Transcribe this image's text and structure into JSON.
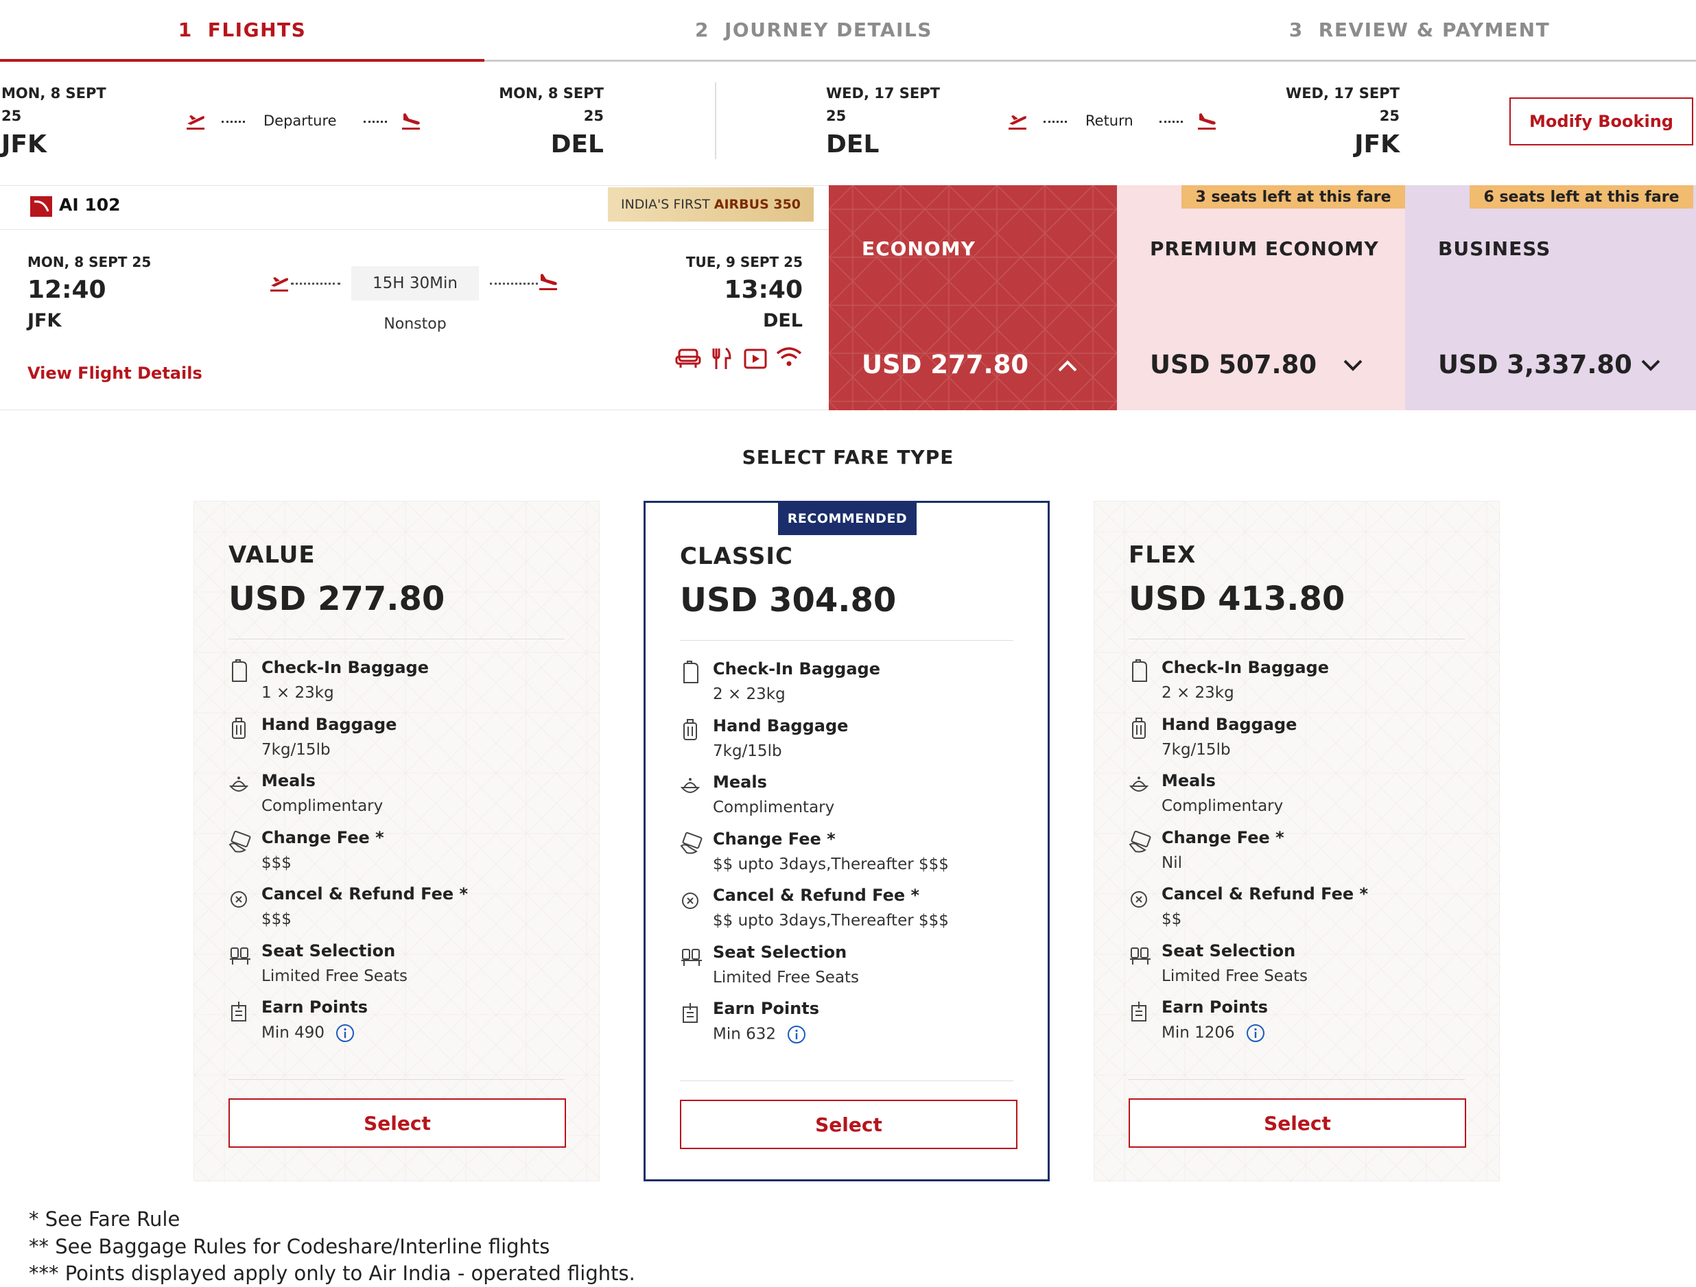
{
  "steps": [
    {
      "num": "1",
      "label": "FLIGHTS"
    },
    {
      "num": "2",
      "label": "JOURNEY DETAILS"
    },
    {
      "num": "3",
      "label": "REVIEW & PAYMENT"
    }
  ],
  "journey": {
    "outbound": {
      "dep_date": "MON, 8 SEPT",
      "dep_year": "25",
      "dep_code": "JFK",
      "label": "Departure",
      "arr_date": "MON, 8 SEPT",
      "arr_year": "25",
      "arr_code": "DEL"
    },
    "return": {
      "dep_date": "WED, 17 SEPT",
      "dep_year": "25",
      "dep_code": "DEL",
      "label": "Return",
      "arr_date": "WED, 17 SEPT",
      "arr_year": "25",
      "arr_code": "JFK"
    },
    "modify_label": "Modify Booking"
  },
  "flight": {
    "number": "AI 102",
    "badge_prefix": "INDIA'S FIRST",
    "badge_bold": "AIRBUS 350",
    "dep_date": "MON, 8 SEPT 25",
    "dep_time": "12:40",
    "dep_code": "JFK",
    "arr_date": "TUE, 9 SEPT 25",
    "arr_time": "13:40",
    "arr_code": "DEL",
    "duration": "15H 30Min",
    "stops": "Nonstop",
    "details_link": "View Flight Details",
    "amenity_icons": [
      "seat-icon",
      "meal-icon",
      "entertainment-icon",
      "wifi-icon"
    ]
  },
  "cabins": [
    {
      "name": "ECONOMY",
      "price": "USD 277.80",
      "seats_left": "",
      "expanded": true,
      "color": "#bd3b3e"
    },
    {
      "name": "PREMIUM ECONOMY",
      "price": "USD 507.80",
      "seats_left": "3 seats left at this fare",
      "expanded": false,
      "color": "#f8e0e3"
    },
    {
      "name": "BUSINESS",
      "price": "USD 3,337.80",
      "seats_left": "6 seats left at this fare",
      "expanded": false,
      "color": "#e5d6ea"
    }
  ],
  "fare_section_title": "SELECT FARE TYPE",
  "recommended_label": "RECOMMENDED",
  "fares": [
    {
      "name": "VALUE",
      "price": "USD 277.80",
      "features": [
        {
          "icon": "checkin-baggage-icon",
          "title": "Check-In Baggage",
          "value": "1 × 23kg"
        },
        {
          "icon": "hand-baggage-icon",
          "title": "Hand Baggage",
          "value": "7kg/15lb"
        },
        {
          "icon": "meals-icon",
          "title": "Meals",
          "value": "Complimentary"
        },
        {
          "icon": "change-fee-icon",
          "title": "Change Fee *",
          "value": "$$$"
        },
        {
          "icon": "cancel-icon",
          "title": "Cancel & Refund Fee *",
          "value": "$$$"
        },
        {
          "icon": "seat-selection-icon",
          "title": "Seat Selection",
          "value": "Limited Free Seats"
        },
        {
          "icon": "earn-points-icon",
          "title": "Earn Points",
          "value": "Min 490"
        }
      ],
      "select_label": "Select"
    },
    {
      "name": "CLASSIC",
      "price": "USD 304.80",
      "features": [
        {
          "icon": "checkin-baggage-icon",
          "title": "Check-In Baggage",
          "value": "2 × 23kg"
        },
        {
          "icon": "hand-baggage-icon",
          "title": "Hand Baggage",
          "value": "7kg/15lb"
        },
        {
          "icon": "meals-icon",
          "title": "Meals",
          "value": "Complimentary"
        },
        {
          "icon": "change-fee-icon",
          "title": "Change Fee *",
          "value": "$$ upto 3days,Thereafter $$$"
        },
        {
          "icon": "cancel-icon",
          "title": "Cancel & Refund Fee *",
          "value": "$$ upto 3days,Thereafter $$$"
        },
        {
          "icon": "seat-selection-icon",
          "title": "Seat Selection",
          "value": "Limited Free Seats"
        },
        {
          "icon": "earn-points-icon",
          "title": "Earn Points",
          "value": "Min 632"
        }
      ],
      "select_label": "Select"
    },
    {
      "name": "FLEX",
      "price": "USD 413.80",
      "features": [
        {
          "icon": "checkin-baggage-icon",
          "title": "Check-In Baggage",
          "value": "2 × 23kg"
        },
        {
          "icon": "hand-baggage-icon",
          "title": "Hand Baggage",
          "value": "7kg/15lb"
        },
        {
          "icon": "meals-icon",
          "title": "Meals",
          "value": "Complimentary"
        },
        {
          "icon": "change-fee-icon",
          "title": "Change Fee *",
          "value": "Nil"
        },
        {
          "icon": "cancel-icon",
          "title": "Cancel & Refund Fee *",
          "value": "$$"
        },
        {
          "icon": "seat-selection-icon",
          "title": "Seat Selection",
          "value": "Limited Free Seats"
        },
        {
          "icon": "earn-points-icon",
          "title": "Earn Points",
          "value": "Min 1206"
        }
      ],
      "select_label": "Select"
    }
  ],
  "footnotes": [
    "* See Fare Rule",
    "** See Baggage Rules for Codeshare/Interline flights",
    "*** Points displayed apply only to Air India - operated flights."
  ],
  "colors": {
    "brand": "#b7151c",
    "navy": "#1b2e6b",
    "seat_badge": "#f1bb70"
  }
}
